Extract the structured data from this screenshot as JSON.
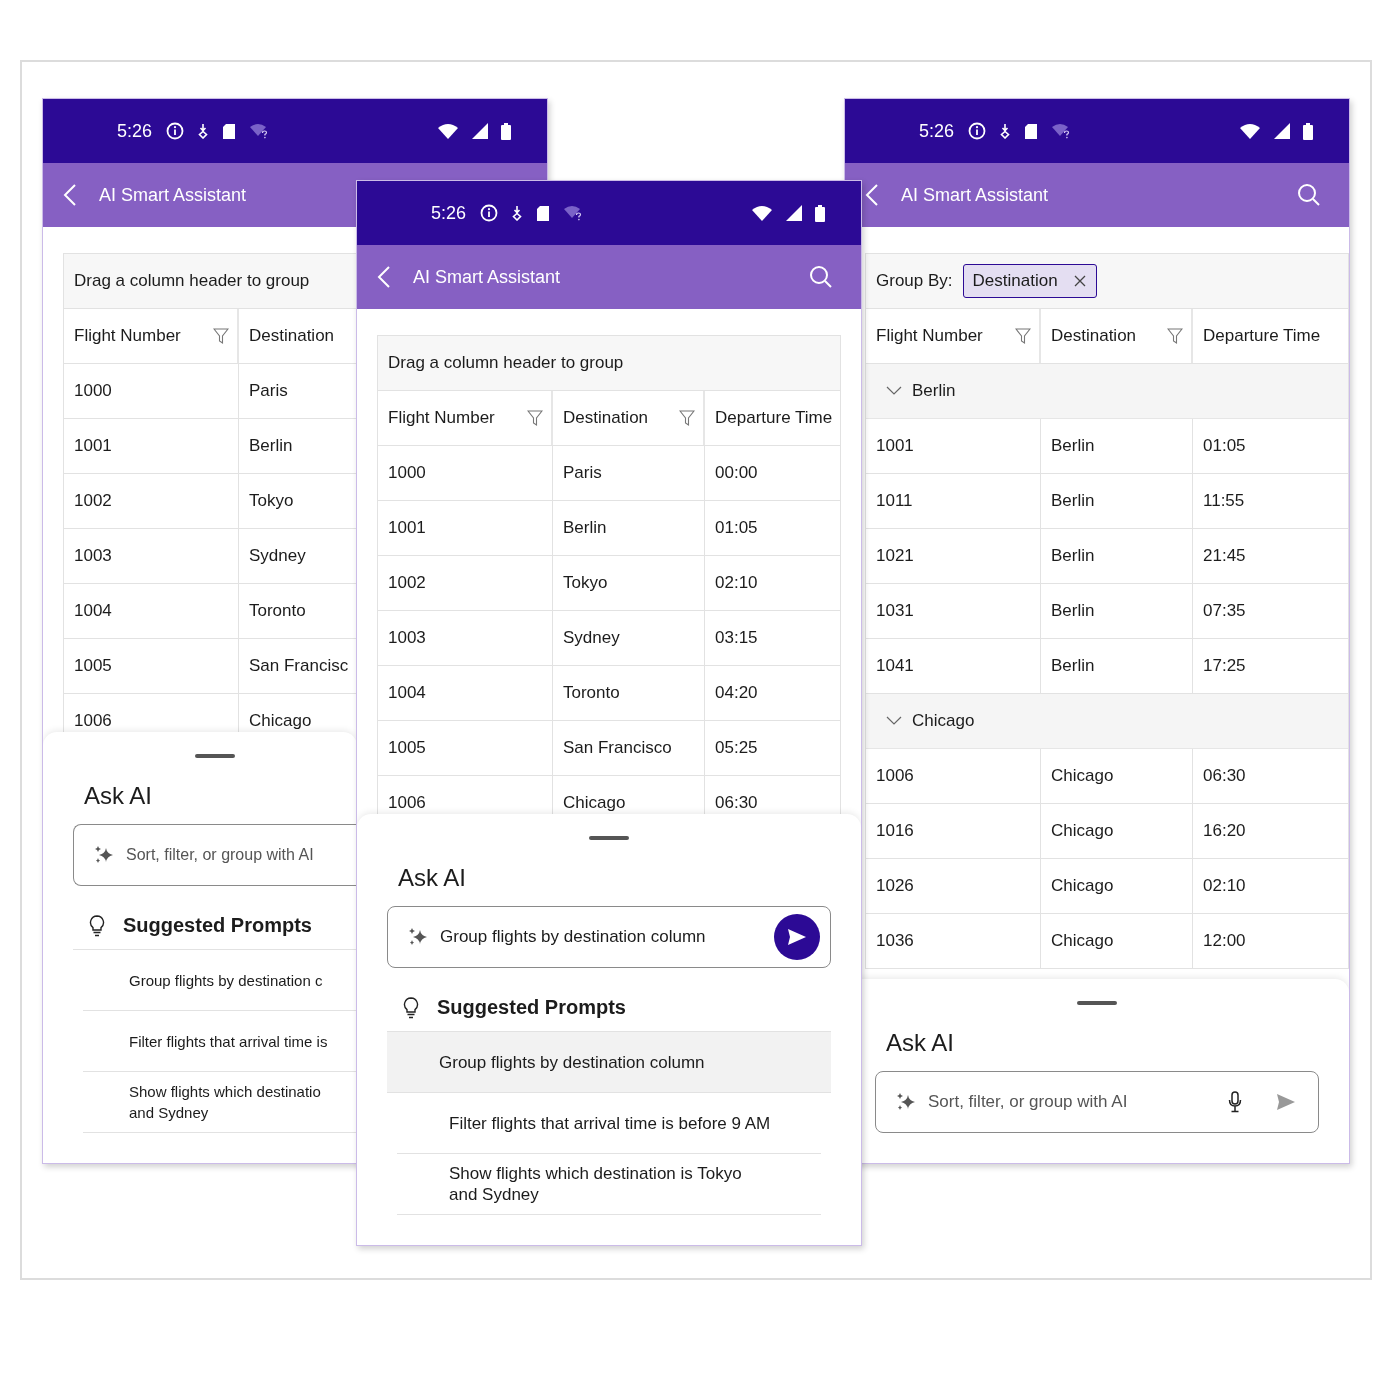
{
  "phones": [
    {
      "status_bar": {
        "time": "5:26"
      },
      "app_bar": {
        "title": "AI Smart Assistant"
      },
      "grid": {
        "group_panel": {
          "kind": "hint",
          "text": "Drag a column header to group"
        },
        "columns": [
          {
            "title": "Flight Number",
            "filter": true
          },
          {
            "title": "Destination",
            "filter": false
          }
        ],
        "rows": [
          {
            "kind": "row",
            "cells": [
              "1000",
              "Paris"
            ]
          },
          {
            "kind": "row",
            "cells": [
              "1001",
              "Berlin"
            ]
          },
          {
            "kind": "row",
            "cells": [
              "1002",
              "Tokyo"
            ]
          },
          {
            "kind": "row",
            "cells": [
              "1003",
              "Sydney"
            ]
          },
          {
            "kind": "row",
            "cells": [
              "1004",
              "Toronto"
            ]
          },
          {
            "kind": "row",
            "cells": [
              "1005",
              "San Francisc"
            ]
          },
          {
            "kind": "row",
            "cells": [
              "1006",
              "Chicago"
            ]
          }
        ]
      },
      "sheet": {
        "title": "Ask AI",
        "input": {
          "placeholder": "Sort, filter, or group with AI"
        },
        "mic": false,
        "suggestions": {
          "title": "Suggested Prompts",
          "items": [
            {
              "lines": [
                "Group flights by destination c"
              ],
              "selected": false
            },
            {
              "lines": [
                "Filter flights that arrival time is"
              ],
              "selected": false
            },
            {
              "lines": [
                "Show flights which destinatio",
                "and Sydney"
              ],
              "selected": false
            }
          ]
        }
      }
    },
    {
      "status_bar": {
        "time": "5:26"
      },
      "app_bar": {
        "title": "AI Smart Assistant",
        "search": true
      },
      "grid": {
        "group_panel": {
          "kind": "hint",
          "text": "Drag a column header to group"
        },
        "columns": [
          {
            "title": "Flight Number",
            "filter": true
          },
          {
            "title": "Destination",
            "filter": true
          },
          {
            "title": "Departure Time",
            "filter": false
          }
        ],
        "rows": [
          {
            "kind": "row",
            "cells": [
              "1000",
              "Paris",
              "00:00"
            ]
          },
          {
            "kind": "row",
            "cells": [
              "1001",
              "Berlin",
              "01:05"
            ]
          },
          {
            "kind": "row",
            "cells": [
              "1002",
              "Tokyo",
              "02:10"
            ]
          },
          {
            "kind": "row",
            "cells": [
              "1003",
              "Sydney",
              "03:15"
            ]
          },
          {
            "kind": "row",
            "cells": [
              "1004",
              "Toronto",
              "04:20"
            ]
          },
          {
            "kind": "row",
            "cells": [
              "1005",
              "San Francisco",
              "05:25"
            ]
          },
          {
            "kind": "row",
            "cells": [
              "1006",
              "Chicago",
              "06:30"
            ]
          }
        ]
      },
      "sheet": {
        "title": "Ask AI",
        "input": {
          "value": "Group flights by destination column"
        },
        "mic": false,
        "send_button": {
          "kind": "filled"
        },
        "suggestions": {
          "title": "Suggested Prompts",
          "items": [
            {
              "lines": [
                "Group flights by destination column"
              ],
              "selected": true
            },
            {
              "lines": [
                "Filter flights that arrival time is before 9 AM"
              ],
              "selected": false
            },
            {
              "lines": [
                "Show flights which destination is Tokyo",
                "and Sydney"
              ],
              "selected": false
            }
          ]
        }
      }
    },
    {
      "status_bar": {
        "time": "5:26"
      },
      "app_bar": {
        "title": "AI Smart Assistant",
        "search": true
      },
      "grid": {
        "group_panel": {
          "kind": "chips",
          "label": "Group By:",
          "chips": [
            "Destination"
          ]
        },
        "columns": [
          {
            "title": "Flight Number",
            "filter": true
          },
          {
            "title": "Destination",
            "filter": true
          },
          {
            "title": "Departure Time",
            "filter": false
          }
        ],
        "rows": [
          {
            "kind": "group",
            "label": "Berlin",
            "expanded": true
          },
          {
            "kind": "row",
            "cells": [
              "1001",
              "Berlin",
              "01:05"
            ]
          },
          {
            "kind": "row",
            "cells": [
              "1011",
              "Berlin",
              "11:55"
            ]
          },
          {
            "kind": "row",
            "cells": [
              "1021",
              "Berlin",
              "21:45"
            ]
          },
          {
            "kind": "row",
            "cells": [
              "1031",
              "Berlin",
              "07:35"
            ]
          },
          {
            "kind": "row",
            "cells": [
              "1041",
              "Berlin",
              "17:25"
            ]
          },
          {
            "kind": "group",
            "label": "Chicago",
            "expanded": true
          },
          {
            "kind": "row",
            "cells": [
              "1006",
              "Chicago",
              "06:30"
            ]
          },
          {
            "kind": "row",
            "cells": [
              "1016",
              "Chicago",
              "16:20"
            ]
          },
          {
            "kind": "row",
            "cells": [
              "1026",
              "Chicago",
              "02:10"
            ]
          },
          {
            "kind": "row",
            "cells": [
              "1036",
              "Chicago",
              "12:00"
            ]
          }
        ]
      },
      "sheet": {
        "title": "Ask AI",
        "input": {
          "placeholder": "Sort, filter, or group with AI"
        },
        "mic": true,
        "send_button": {
          "kind": "plain"
        }
      }
    }
  ]
}
